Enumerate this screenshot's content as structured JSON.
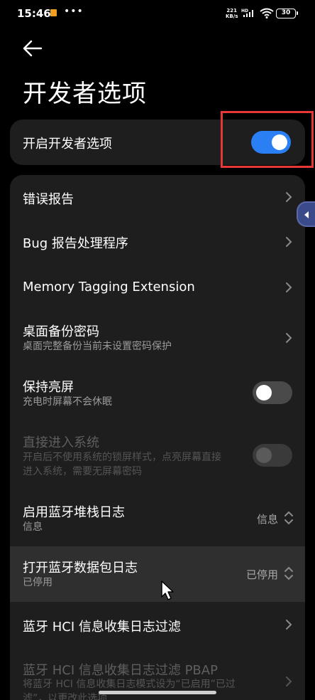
{
  "status_bar": {
    "time": "15:46",
    "dots": "•••",
    "speed_value": "221",
    "speed_unit": "KB/s",
    "network": "HD",
    "battery": "30"
  },
  "header": {
    "title": "开发者选项"
  },
  "master_toggle": {
    "label": "开启开发者选项",
    "state": "on"
  },
  "settings": [
    {
      "title": "错误报告",
      "type": "chevron"
    },
    {
      "title": "Bug 报告处理程序",
      "type": "chevron"
    },
    {
      "title": "Memory Tagging Extension",
      "type": "chevron"
    },
    {
      "title": "桌面备份密码",
      "subtitle": "桌面完整备份当前未设置密码保护",
      "type": "chevron"
    },
    {
      "title": "保持亮屏",
      "subtitle": "充电时屏幕不会休眠",
      "type": "toggle",
      "state": "off"
    },
    {
      "title": "直接进入系统",
      "subtitle_line1": "开启后不使用系统的锁屏样式，点亮屏幕直接",
      "subtitle_line2": "进入系统，需要无屏幕密码",
      "type": "toggle",
      "state": "off",
      "disabled": true
    },
    {
      "title": "启用蓝牙堆栈日志",
      "subtitle": "信息",
      "value": "信息",
      "type": "select"
    },
    {
      "title": "打开蓝牙数据包日志",
      "subtitle": "已停用",
      "value": "已停用",
      "type": "select",
      "highlighted": true
    },
    {
      "title": "蓝牙 HCI 信息收集日志过滤",
      "type": "chevron"
    },
    {
      "title": "蓝牙 HCI 信息收集日志过滤 PBAP",
      "subtitle_line1": "将蓝牙 HCI 信息收集日志模式设为“已启用”已过",
      "subtitle_line2": "滤”，以更改此选项",
      "type": "chevron",
      "disabled": true
    }
  ],
  "colors": {
    "accent": "#2a7ff5",
    "card": "#1e1e1e",
    "highlight": "#2f2f2f",
    "annotation": "#e53935"
  }
}
